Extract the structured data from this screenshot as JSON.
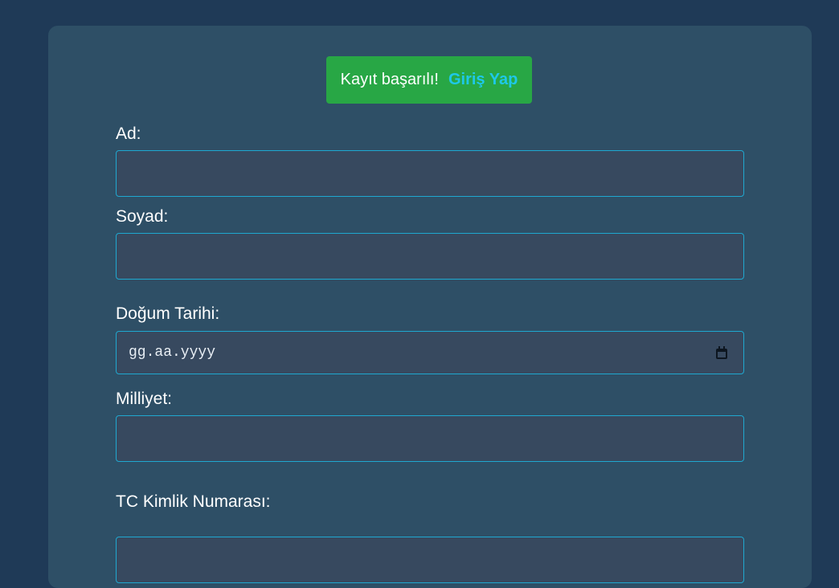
{
  "alert": {
    "message": "Kayıt başarılı!",
    "link_label": "Giriş Yap",
    "background": "#28a745",
    "link_color": "#1ec8e8"
  },
  "form": {
    "first_name": {
      "label": "Ad:",
      "value": ""
    },
    "last_name": {
      "label": "Soyad:",
      "value": ""
    },
    "birth_date": {
      "label": "Doğum Tarihi:",
      "placeholder": "gg.aa.yyyy",
      "icon": "calendar-icon"
    },
    "nationality": {
      "label": "Milliyet:",
      "value": ""
    },
    "tc_number": {
      "label": "TC Kimlik Numarası:",
      "value": ""
    }
  },
  "colors": {
    "page_background": "#1f3a57",
    "card_background": "#2e4f66",
    "field_background": "#37495f",
    "field_border": "#1fa8d0"
  }
}
